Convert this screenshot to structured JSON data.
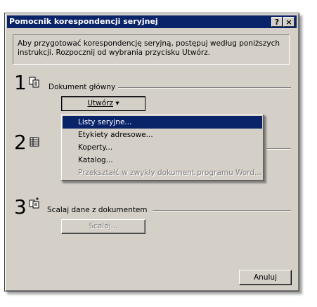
{
  "window": {
    "title": "Pomocnik korespondencji seryjnej"
  },
  "titlebar": {
    "help_label": "?",
    "close_label": "×"
  },
  "intro_text": "Aby przygotować korespondencję seryjną, postępuj według poniższych instrukcji. Rozpocznij od wybrania przycisku Utwórz.",
  "steps": [
    {
      "number": "1",
      "label": "Dokument główny",
      "icon": "document-icon"
    },
    {
      "number": "2",
      "label": "",
      "icon": "data-source-icon"
    },
    {
      "number": "3",
      "label": "Scalaj dane z dokumentem",
      "icon": "merge-icon"
    }
  ],
  "create_button": {
    "label": "Utwórz",
    "arrow": "▾"
  },
  "create_menu": {
    "items": [
      {
        "label": "Listy seryjne...",
        "selected": true,
        "enabled": true
      },
      {
        "label": "Etykiety adresowe...",
        "selected": false,
        "enabled": true
      },
      {
        "label": "Koperty...",
        "selected": false,
        "enabled": true
      },
      {
        "label": "Katalog...",
        "selected": false,
        "enabled": true
      },
      {
        "label": "Przekształć w zwykły dokument programu Word...",
        "selected": false,
        "enabled": false
      }
    ]
  },
  "merge_button": {
    "label": "Scalaj..."
  },
  "cancel_button": {
    "label": "Anuluj"
  },
  "colors": {
    "titlebar": "#0a246a",
    "face": "#d4d0c8",
    "highlight": "#0a246a"
  }
}
